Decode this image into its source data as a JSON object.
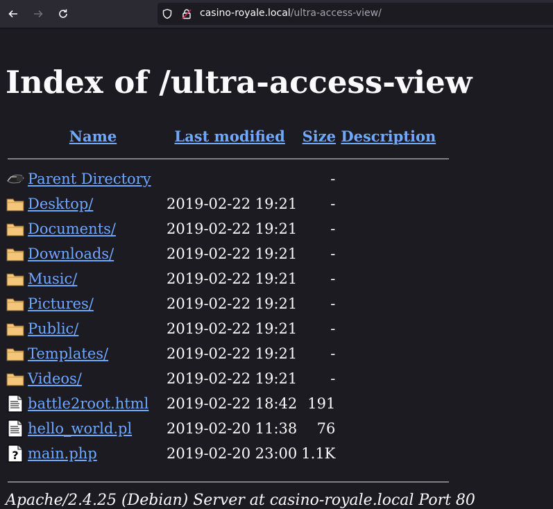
{
  "browser": {
    "url_host": "casino-royale.local",
    "url_path": "/ultra-access-view/"
  },
  "page": {
    "title": "Index of /ultra-access-view",
    "columns": {
      "name": "Name",
      "last_modified": "Last modified",
      "size": "Size",
      "description": "Description"
    },
    "entries": [
      {
        "icon": "back-icon",
        "name": "Parent Directory",
        "date": "",
        "size": "-"
      },
      {
        "icon": "folder-icon",
        "name": "Desktop/",
        "date": "2019-02-22 19:21",
        "size": "-"
      },
      {
        "icon": "folder-icon",
        "name": "Documents/",
        "date": "2019-02-22 19:21",
        "size": "-"
      },
      {
        "icon": "folder-icon",
        "name": "Downloads/",
        "date": "2019-02-22 19:21",
        "size": "-"
      },
      {
        "icon": "folder-icon",
        "name": "Music/",
        "date": "2019-02-22 19:21",
        "size": "-"
      },
      {
        "icon": "folder-icon",
        "name": "Pictures/",
        "date": "2019-02-22 19:21",
        "size": "-"
      },
      {
        "icon": "folder-icon",
        "name": "Public/",
        "date": "2019-02-22 19:21",
        "size": "-"
      },
      {
        "icon": "folder-icon",
        "name": "Templates/",
        "date": "2019-02-22 19:21",
        "size": "-"
      },
      {
        "icon": "folder-icon",
        "name": "Videos/",
        "date": "2019-02-22 19:21",
        "size": "-"
      },
      {
        "icon": "text-file-icon",
        "name": "battle2root.html",
        "date": "2019-02-22 18:42",
        "size": "191"
      },
      {
        "icon": "text-file-icon",
        "name": "hello_world.pl",
        "date": "2019-02-20 11:38",
        "size": "76"
      },
      {
        "icon": "unknown-file-icon",
        "name": "main.php",
        "date": "2019-02-20 23:00",
        "size": "1.1K"
      }
    ],
    "footer": "Apache/2.4.25 (Debian) Server at casino-royale.local Port 80"
  },
  "colors": {
    "background": "#1c1b22",
    "toolbar": "#2b2a33",
    "link": "#6fa8ff",
    "text": "#fbfbfe",
    "folder": "#f5c57a"
  }
}
